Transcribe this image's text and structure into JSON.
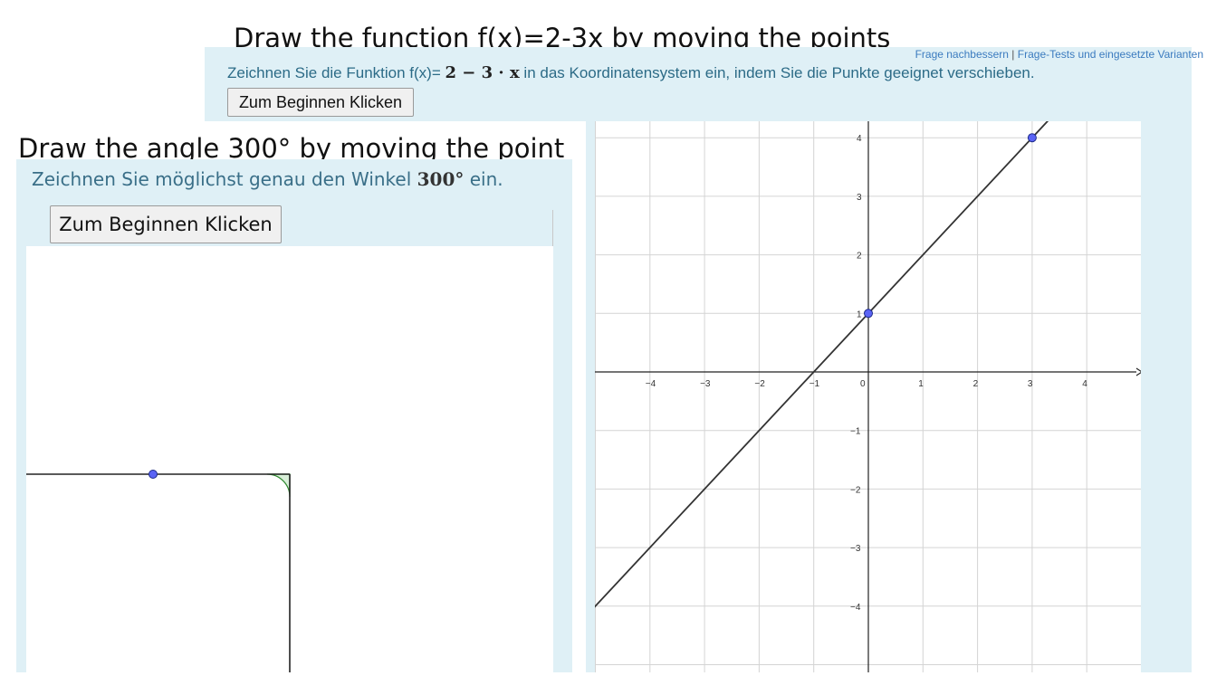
{
  "captions": {
    "function": "Draw the function f(x)=2-3x by moving the points",
    "angle": "Draw the angle 300° by moving the point"
  },
  "function_task": {
    "text_before": "Zeichnen Sie die Funktion f(x)= ",
    "formula": "2 − 3 · x",
    "text_after": " in das Koordinatensystem ein, indem Sie die Punkte geeignet verschieben.",
    "button_label": "Zum Beginnen Klicken",
    "links": {
      "improve": "Frage nachbessern",
      "separator": " | ",
      "tests": "Frage-Tests und eingesetzte Varianten"
    }
  },
  "angle_task": {
    "text_before": "Zeichnen Sie möglichst genau den Winkel ",
    "angle_value": "300°",
    "text_after": " ein.",
    "button_label": "Zum Beginnen Klicken"
  },
  "graph": {
    "x_ticks": [
      "−4",
      "−3",
      "−2",
      "−1",
      "0",
      "1",
      "2",
      "3",
      "4"
    ],
    "y_ticks_positive": [
      "4",
      "3",
      "2",
      "1"
    ],
    "y_ticks_negative": [
      "−1",
      "−2",
      "−3",
      "−4"
    ],
    "points": [
      {
        "x": 0,
        "y": 1
      },
      {
        "x": 3,
        "y": 4
      }
    ],
    "line": {
      "slope": 1,
      "intercept": 1
    }
  },
  "colors": {
    "panel": "#dff0f6",
    "point_fill": "#5b64f5",
    "angle_fill": "#d9efd9",
    "angle_stroke": "#2f8a2f"
  }
}
